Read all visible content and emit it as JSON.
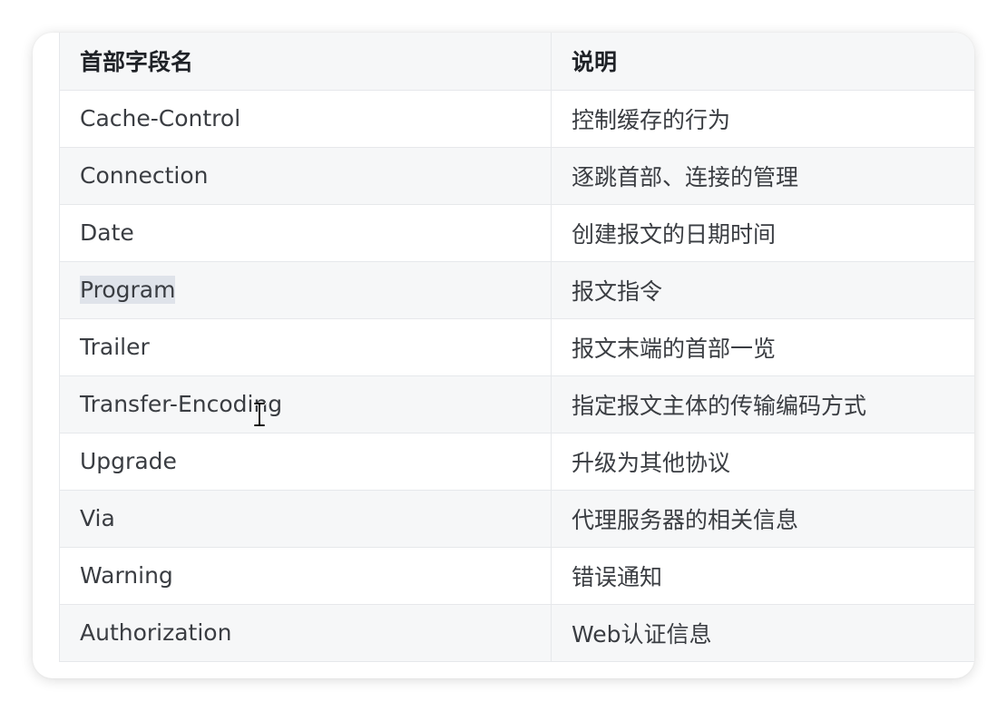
{
  "table": {
    "headers": [
      "首部字段名",
      "说明"
    ],
    "rows": [
      {
        "field": "Cache-Control",
        "desc": "控制缓存的行为"
      },
      {
        "field": "Connection",
        "desc": "逐跳首部、连接的管理"
      },
      {
        "field": "Date",
        "desc": "创建报文的日期时间"
      },
      {
        "field": "Program",
        "desc": "报文指令"
      },
      {
        "field": "Trailer",
        "desc": "报文末端的首部一览"
      },
      {
        "field": "Transfer-Encoding",
        "desc": "指定报文主体的传输编码方式"
      },
      {
        "field": "Upgrade",
        "desc": "升级为其他协议"
      },
      {
        "field": "Via",
        "desc": "代理服务器的相关信息"
      },
      {
        "field": "Warning",
        "desc": "错误通知"
      },
      {
        "field": "Authorization",
        "desc": "Web认证信息"
      }
    ]
  },
  "selection": {
    "row": 3,
    "color": "#dfe3ea"
  },
  "cursor": {
    "icon": "text-cursor-icon"
  }
}
